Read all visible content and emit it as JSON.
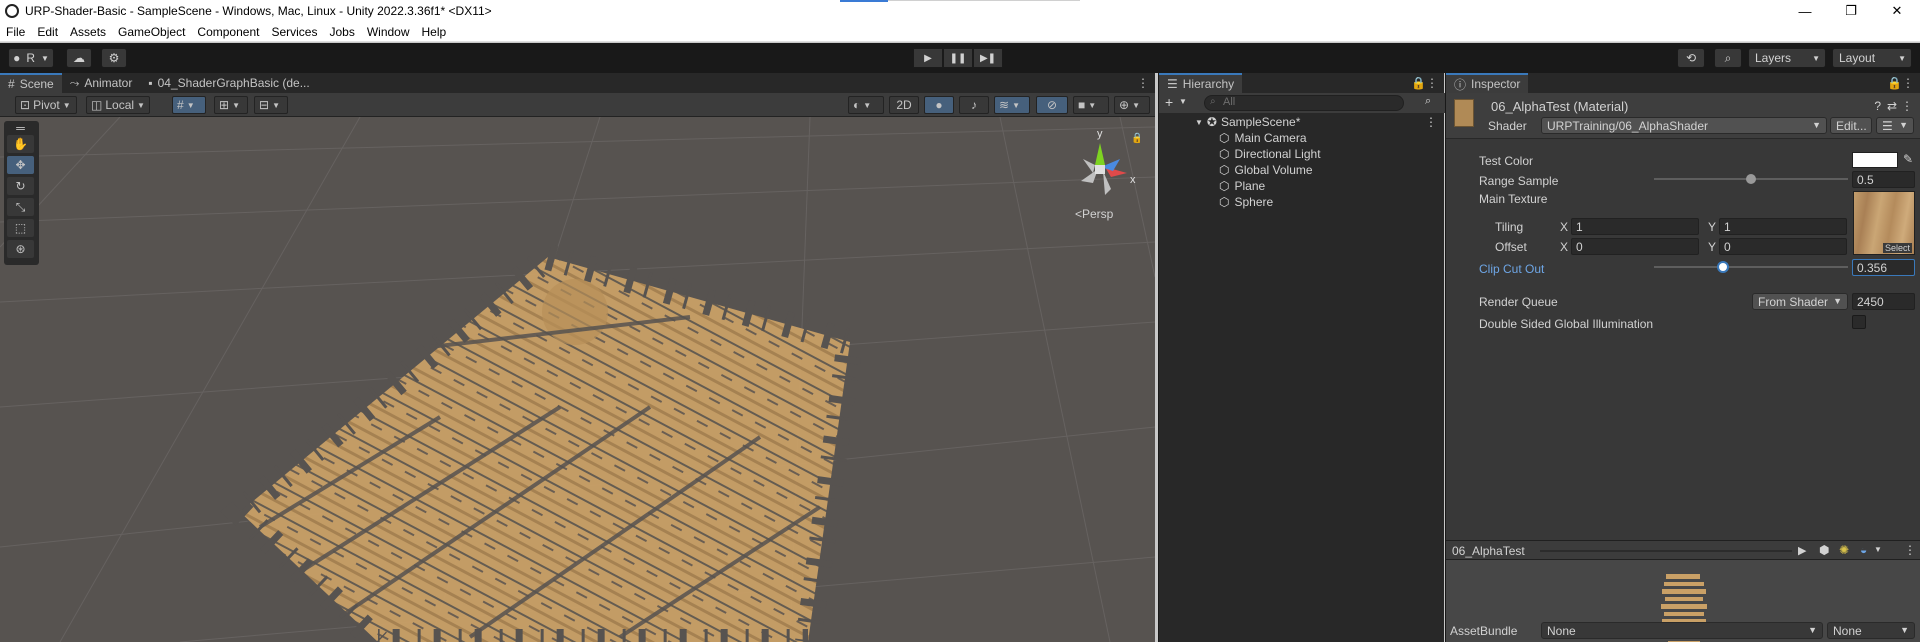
{
  "window": {
    "title": "URP-Shader-Basic - SampleScene - Windows, Mac, Linux - Unity 2022.3.36f1* <DX11>",
    "controls": [
      "—",
      "❐",
      "✕"
    ]
  },
  "menu": [
    "File",
    "Edit",
    "Assets",
    "GameObject",
    "Component",
    "Services",
    "Jobs",
    "Window",
    "Help"
  ],
  "toolbar": {
    "account_label": "R",
    "layers_label": "Layers",
    "layout_label": "Layout"
  },
  "scene_panel": {
    "tabs": [
      "Scene",
      "Animator",
      "04_ShaderGraphBasic (de..."
    ],
    "pivot_label": "Pivot",
    "local_label": "Local",
    "mode_2d_label": "2D",
    "persp_label": "<Persp",
    "gizmo_axes": {
      "y": "y",
      "x": "x"
    }
  },
  "hierarchy": {
    "tab": "Hierarchy",
    "search_placeholder": "All",
    "scene_name": "SampleScene*",
    "items": [
      "Main Camera",
      "Directional Light",
      "Global Volume",
      "Plane",
      "Sphere"
    ]
  },
  "inspector": {
    "tab": "Inspector",
    "material_name": "06_AlphaTest (Material)",
    "shader_label": "Shader",
    "shader_value": "URPTraining/06_AlphaShader",
    "edit_label": "Edit...",
    "props": {
      "test_color_label": "Test Color",
      "range_sample_label": "Range Sample",
      "range_sample_value": "0.5",
      "range_sample_fraction": 0.5,
      "main_texture_label": "Main Texture",
      "tiling_label": "Tiling",
      "tiling_x": "1",
      "tiling_y": "1",
      "offset_label": "Offset",
      "offset_x": "0",
      "offset_y": "0",
      "axis_x": "X",
      "axis_y": "Y",
      "select_label": "Select",
      "clip_label": "Clip Cut Out",
      "clip_value": "0.356",
      "clip_fraction": 0.356,
      "render_queue_label": "Render Queue",
      "render_queue_source": "From Shader",
      "render_queue_value": "2450",
      "double_sided_label": "Double Sided Global Illumination"
    },
    "preview_title": "06_AlphaTest",
    "assetbundle_label": "AssetBundle",
    "assetbundle_value": "None",
    "assetbundle_variant": "None"
  },
  "colors": {
    "accent": "#3a79bb",
    "wood": "#c9a066",
    "ground": "#575350"
  }
}
